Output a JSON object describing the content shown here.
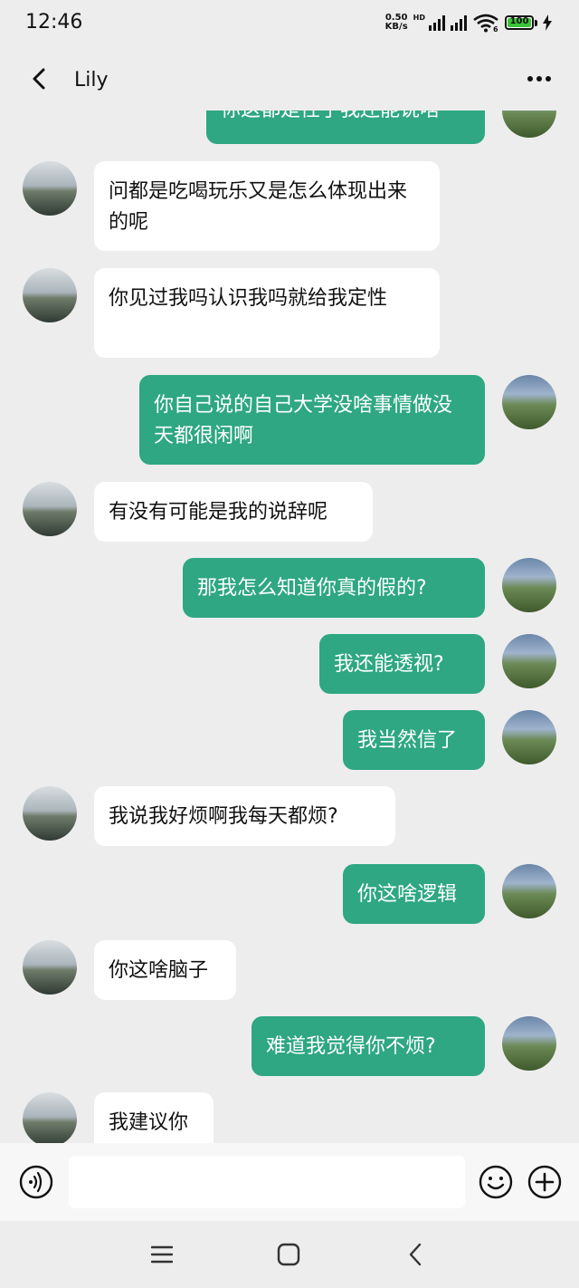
{
  "status": {
    "time": "12:46",
    "net_speed_value": "0.50",
    "net_speed_unit": "KB/s",
    "hd_label": "HD",
    "wifi_badge": "6",
    "battery_level": "100"
  },
  "header": {
    "contact_name": "Lily",
    "back_icon": "chevron-left-icon",
    "more_icon": "ellipsis-icon"
  },
  "messages": [
    {
      "side": "out",
      "text": "你这都是性了我还能说啥"
    },
    {
      "side": "in",
      "text": "问都是吃喝玩乐又是怎么体现出来的呢"
    },
    {
      "side": "in",
      "text": "你见过我吗认识我吗就给我定性"
    },
    {
      "side": "out",
      "text": "你自己说的自己大学没啥事情做没天都很闲啊"
    },
    {
      "side": "in",
      "text": "有没有可能是我的说辞呢"
    },
    {
      "side": "out",
      "text": "那我怎么知道你真的假的?"
    },
    {
      "side": "out",
      "text": "我还能透视?"
    },
    {
      "side": "out",
      "text": "我当然信了"
    },
    {
      "side": "in",
      "text": "我说我好烦啊我每天都烦?"
    },
    {
      "side": "out",
      "text": "你这啥逻辑"
    },
    {
      "side": "in",
      "text": "你这啥脑子"
    },
    {
      "side": "out",
      "text": "难道我觉得你不烦?"
    },
    {
      "side": "in",
      "text": "我建议你"
    }
  ],
  "input": {
    "value": "",
    "voice_icon": "voice-icon",
    "emoji_icon": "emoji-icon",
    "plus_icon": "plus-icon"
  },
  "navbar": {
    "menu_icon": "menu-icon",
    "home_icon": "home-icon",
    "back_icon": "back-triangle-icon"
  },
  "colors": {
    "outgoing_bubble": "#2ea782",
    "incoming_bubble": "#ffffff",
    "chat_background": "#ededed",
    "battery_fill": "#3bc43b"
  }
}
